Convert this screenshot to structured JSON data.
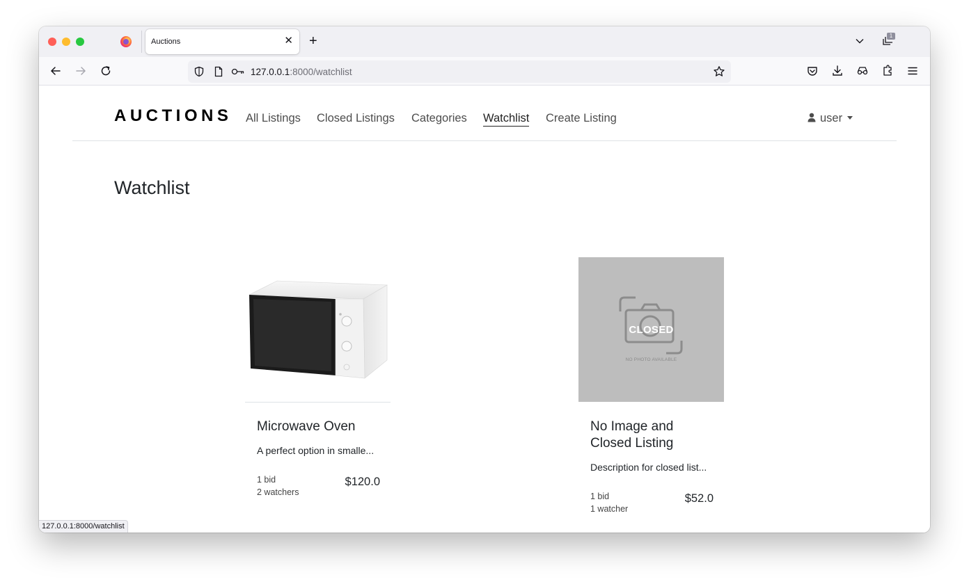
{
  "browser": {
    "tab_title": "Auctions",
    "tab_count": "1",
    "url_host": "127.0.0.1",
    "url_rest": ":8000/watchlist",
    "status_url": "127.0.0.1:8000/watchlist"
  },
  "site": {
    "brand": "AUCTIONS",
    "nav": [
      {
        "label": "All Listings"
      },
      {
        "label": "Closed Listings"
      },
      {
        "label": "Categories"
      },
      {
        "label": "Watchlist",
        "active": true
      },
      {
        "label": "Create Listing"
      }
    ],
    "user_label": "user"
  },
  "page": {
    "title": "Watchlist"
  },
  "listings": [
    {
      "title": "Microwave Oven",
      "description": "A perfect option in smalle...",
      "bids": "1 bid",
      "watchers": "2 watchers",
      "price": "$120.0",
      "image": "microwave"
    },
    {
      "title": "No Image and Closed Listing",
      "description": "Description for closed list...",
      "bids": "1 bid",
      "watchers": "1 watcher",
      "price": "$52.0",
      "image": "placeholder",
      "closed_label": "CLOSED",
      "placeholder_text": "NO PHOTO AVAILABLE"
    }
  ],
  "colors": {
    "page_bg": "#ffffff",
    "tabstrip_bg": "#f0f0f4",
    "placeholder_bg": "#bdbdbd",
    "text": "#212529"
  }
}
